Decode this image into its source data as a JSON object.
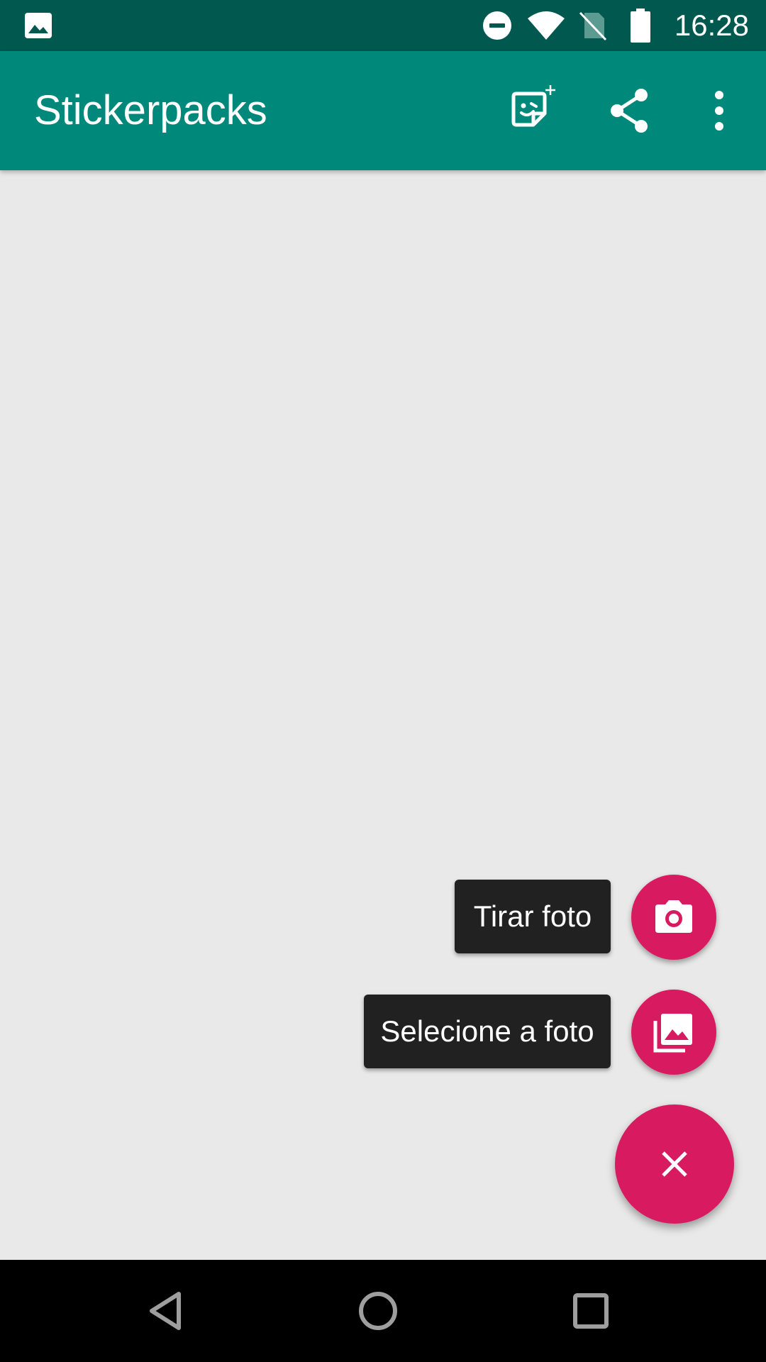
{
  "status_bar": {
    "time": "16:28",
    "icons": [
      "image-notification-icon",
      "do-not-disturb-icon",
      "wifi-icon",
      "no-sim-icon",
      "battery-icon"
    ]
  },
  "app_bar": {
    "title": "Stickerpacks",
    "actions": [
      "add-sticker-icon",
      "share-icon",
      "more-vert-icon"
    ],
    "color": "#00897b",
    "status_color": "#00584f"
  },
  "fab_menu": {
    "take_photo_label": "Tirar foto",
    "select_photo_label": "Selecione a foto",
    "accent": "#d81b60",
    "main_icon": "close-icon"
  },
  "nav_bar": {
    "icons": [
      "back-icon",
      "home-icon",
      "recents-icon"
    ]
  }
}
